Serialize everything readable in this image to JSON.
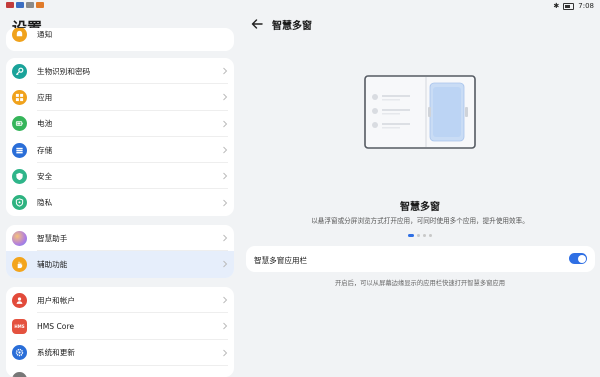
{
  "status_bar": {
    "time": "7:08",
    "battery_icon": "battery-icon"
  },
  "settings": {
    "title": "设置",
    "partial_item": "通知",
    "group1": [
      {
        "label": "生物识别和密码",
        "icon": "key-icon",
        "color": "#1aa39a"
      },
      {
        "label": "应用",
        "icon": "apps-grid-icon",
        "color": "#f0a21c"
      },
      {
        "label": "电池",
        "icon": "battery-icon",
        "color": "#35b55a"
      },
      {
        "label": "存储",
        "icon": "storage-icon",
        "color": "#2a6ed8"
      },
      {
        "label": "安全",
        "icon": "shield-icon",
        "color": "#2fb58a"
      },
      {
        "label": "隐私",
        "icon": "privacy-shield-icon",
        "color": "#2eb380"
      }
    ],
    "group2": [
      {
        "label": "智慧助手",
        "icon": "assistant-orb-icon",
        "color": "#9b7bd8"
      },
      {
        "label": "辅助功能",
        "icon": "hand-icon",
        "color": "#f3a51d"
      }
    ],
    "group3": [
      {
        "label": "用户和帐户",
        "icon": "user-icon",
        "color": "#e24b3b"
      },
      {
        "label": "HMS Core",
        "icon": "hms-core-icon",
        "color": "#e4523f"
      },
      {
        "label": "系统和更新",
        "icon": "settings-gear-icon",
        "color": "#2a6ed8"
      }
    ]
  },
  "detail": {
    "title": "智慧多窗",
    "feature_title": "智慧多窗",
    "feature_desc": "以悬浮窗或分屏浏览方式打开应用，可同时使用多个应用，提升使用效率。",
    "pager": {
      "count": 4,
      "active_index": 0
    },
    "toggle_label": "智慧多窗应用栏",
    "toggle_on": true,
    "hint": "开启后，可以从屏幕边缘显示的应用栏快速打开智慧多窗应用",
    "accent_color": "#2f6fe4"
  }
}
